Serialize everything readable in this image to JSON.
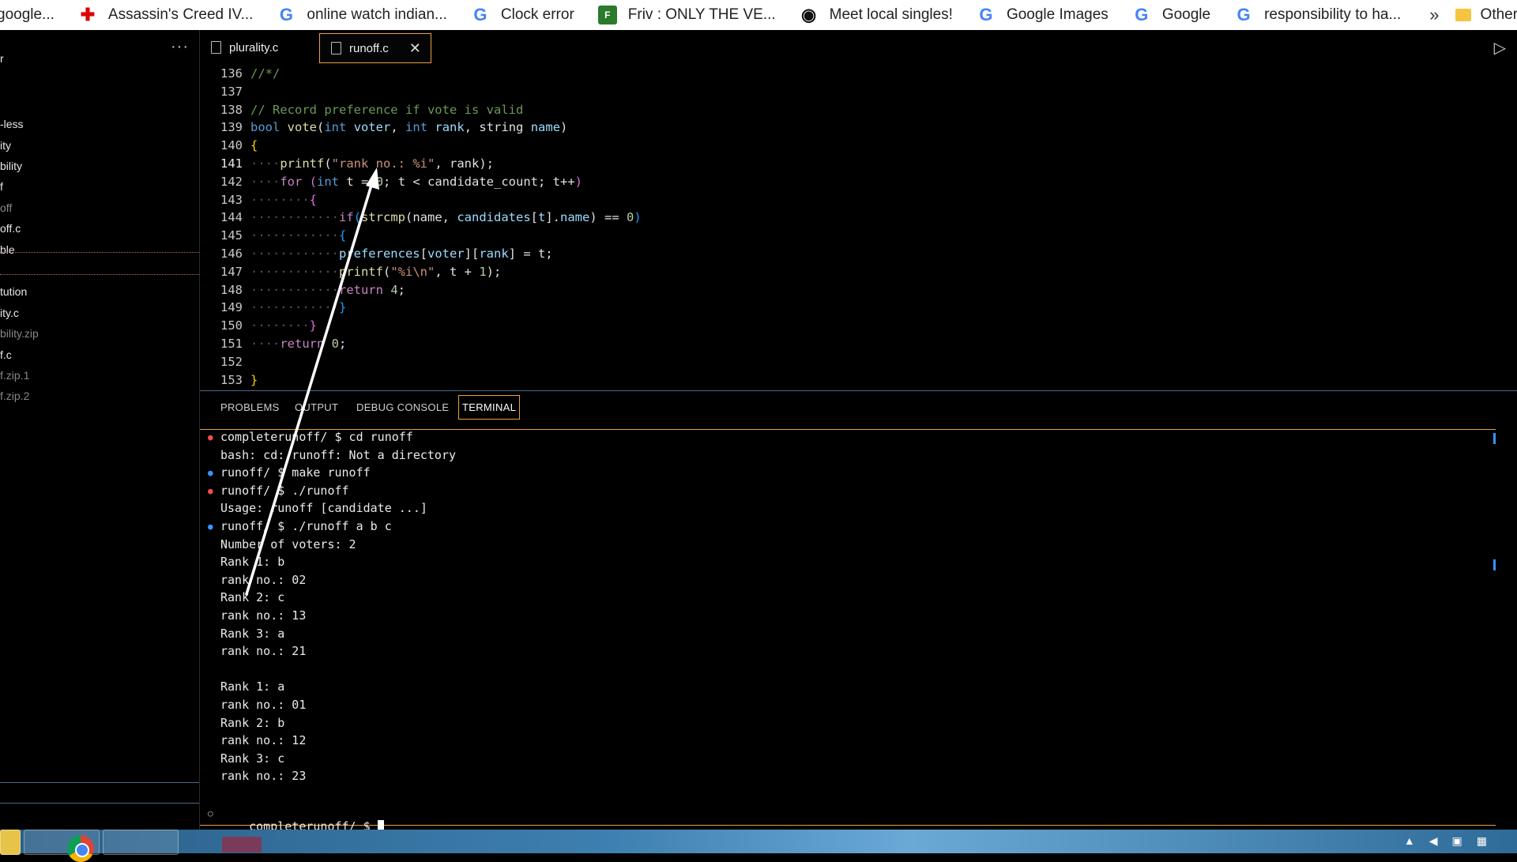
{
  "bookmarks": {
    "items": [
      {
        "label": "google...",
        "icon": "none"
      },
      {
        "label": "Assassin's Creed IV...",
        "icon": "gamepad-icon"
      },
      {
        "label": "online watch indian...",
        "icon": "google-icon"
      },
      {
        "label": "Clock error",
        "icon": "google-icon"
      },
      {
        "label": "Friv : ONLY THE VE...",
        "icon": "friv-icon"
      },
      {
        "label": "Meet local singles!",
        "icon": "globe-icon"
      },
      {
        "label": "Google Images",
        "icon": "google-icon"
      },
      {
        "label": "Google",
        "icon": "google-icon"
      },
      {
        "label": "responsibility to ha...",
        "icon": "google-icon"
      }
    ],
    "more": "»",
    "other": "Other"
  },
  "sidebar": {
    "more": "···",
    "items": [
      {
        "label": "r",
        "dim": false
      },
      {
        "label": "",
        "dim": false
      },
      {
        "label": "-less",
        "dim": false
      },
      {
        "label": "ity",
        "dim": false
      },
      {
        "label": "bility",
        "dim": false
      },
      {
        "label": "f",
        "dim": false
      },
      {
        "label": "off",
        "dim": true
      },
      {
        "label": "off.c",
        "dim": false
      },
      {
        "label": "ble",
        "dim": false
      },
      {
        "label": "",
        "dim": false
      },
      {
        "label": "tution",
        "dim": false
      },
      {
        "label": "ity.c",
        "dim": false
      },
      {
        "label": "bility.zip",
        "dim": true
      },
      {
        "label": "f.c",
        "dim": false
      },
      {
        "label": "f.zip.1",
        "dim": true
      },
      {
        "label": "f.zip.2",
        "dim": true
      }
    ]
  },
  "tabs": [
    {
      "label": "plurality.c",
      "active": false
    },
    {
      "label": "runoff.c",
      "active": true
    }
  ],
  "tab_close": "✕",
  "run_icon": "▷",
  "editor": {
    "current_line": 141,
    "lines": [
      {
        "n": 136,
        "tokens": [
          [
            "cmt",
            "//*/"
          ]
        ]
      },
      {
        "n": 137,
        "tokens": []
      },
      {
        "n": 138,
        "tokens": [
          [
            "cmt",
            "// Record preference if vote is valid"
          ]
        ]
      },
      {
        "n": 139,
        "tokens": [
          [
            "kw",
            "bool"
          ],
          [
            "txt",
            " "
          ],
          [
            "fn",
            "vote"
          ],
          [
            "txt",
            "("
          ],
          [
            "kw",
            "int"
          ],
          [
            "txt",
            " "
          ],
          [
            "var",
            "voter"
          ],
          [
            "txt",
            ", "
          ],
          [
            "kw",
            "int"
          ],
          [
            "txt",
            " "
          ],
          [
            "var",
            "rank"
          ],
          [
            "txt",
            ", "
          ],
          [
            "txt",
            "string"
          ],
          [
            "txt",
            " "
          ],
          [
            "var",
            "name"
          ],
          [
            "txt",
            ")"
          ]
        ]
      },
      {
        "n": 140,
        "tokens": [
          [
            "br1",
            "{"
          ]
        ]
      },
      {
        "n": 141,
        "tokens": [
          [
            "ws",
            "····"
          ],
          [
            "fn",
            "printf"
          ],
          [
            "txt",
            "("
          ],
          [
            "str",
            "\"rank no.: %i\""
          ],
          [
            "txt",
            ", rank);"
          ]
        ]
      },
      {
        "n": 142,
        "tokens": [
          [
            "ws",
            "····"
          ],
          [
            "ctl",
            "for"
          ],
          [
            "txt",
            " "
          ],
          [
            "br2",
            "("
          ],
          [
            "kw",
            "int"
          ],
          [
            "txt",
            " t = "
          ],
          [
            "num",
            "0"
          ],
          [
            "txt",
            "; t < candidate_count; t++"
          ],
          [
            "br2",
            ")"
          ]
        ]
      },
      {
        "n": 143,
        "tokens": [
          [
            "ws",
            "········"
          ],
          [
            "br2",
            "{"
          ]
        ]
      },
      {
        "n": 144,
        "tokens": [
          [
            "ws",
            "············"
          ],
          [
            "ctl",
            "if"
          ],
          [
            "br3",
            "("
          ],
          [
            "fn",
            "strcmp"
          ],
          [
            "txt",
            "(name, "
          ],
          [
            "var",
            "candidates"
          ],
          [
            "txt",
            "["
          ],
          [
            "var",
            "t"
          ],
          [
            "txt",
            "]."
          ],
          [
            "var",
            "name"
          ],
          [
            "txt",
            ") == "
          ],
          [
            "num",
            "0"
          ],
          [
            "br3",
            ")"
          ]
        ]
      },
      {
        "n": 145,
        "tokens": [
          [
            "ws",
            "············"
          ],
          [
            "br3",
            "{"
          ]
        ]
      },
      {
        "n": 146,
        "tokens": [
          [
            "ws",
            "············"
          ],
          [
            "var",
            "preferences"
          ],
          [
            "txt",
            "["
          ],
          [
            "var",
            "voter"
          ],
          [
            "txt",
            "]["
          ],
          [
            "var",
            "rank"
          ],
          [
            "txt",
            "] = t;"
          ]
        ]
      },
      {
        "n": 147,
        "tokens": [
          [
            "ws",
            "············"
          ],
          [
            "fn",
            "printf"
          ],
          [
            "txt",
            "("
          ],
          [
            "str",
            "\"%i\\n\""
          ],
          [
            "txt",
            ", t + "
          ],
          [
            "num",
            "1"
          ],
          [
            "txt",
            ");"
          ]
        ]
      },
      {
        "n": 148,
        "tokens": [
          [
            "ws",
            "············"
          ],
          [
            "ctl",
            "return"
          ],
          [
            "txt",
            " "
          ],
          [
            "num",
            "4"
          ],
          [
            "txt",
            ";"
          ]
        ]
      },
      {
        "n": 149,
        "tokens": [
          [
            "ws",
            "············"
          ],
          [
            "br3",
            "}"
          ]
        ]
      },
      {
        "n": 150,
        "tokens": [
          [
            "ws",
            "········"
          ],
          [
            "br2",
            "}"
          ]
        ]
      },
      {
        "n": 151,
        "tokens": [
          [
            "ws",
            "····"
          ],
          [
            "ctl",
            "return"
          ],
          [
            "txt",
            " "
          ],
          [
            "num",
            "0"
          ],
          [
            "txt",
            ";"
          ]
        ]
      },
      {
        "n": 152,
        "tokens": []
      },
      {
        "n": 153,
        "tokens": [
          [
            "br1",
            "}"
          ]
        ]
      }
    ]
  },
  "panel": {
    "tabs": [
      "PROBLEMS",
      "OUTPUT",
      "DEBUG CONSOLE",
      "TERMINAL"
    ],
    "active": "TERMINAL"
  },
  "terminal": {
    "lines": [
      {
        "text": "completerunoff/ $ cd runoff",
        "dot": "err"
      },
      {
        "text": "bash: cd: runoff: Not a directory",
        "dot": ""
      },
      {
        "text": "runoff/ $ make runoff",
        "dot": "ok"
      },
      {
        "text": "runoff/ $ ./runoff",
        "dot": "err"
      },
      {
        "text": "Usage: runoff [candidate ...]",
        "dot": ""
      },
      {
        "text": "runoff/ $ ./runoff a b c",
        "dot": "ok"
      },
      {
        "text": "Number of voters: 2",
        "dot": ""
      },
      {
        "text": "Rank 1: b",
        "dot": ""
      },
      {
        "text": "rank no.: 02",
        "dot": ""
      },
      {
        "text": "Rank 2: c",
        "dot": ""
      },
      {
        "text": "rank no.: 13",
        "dot": ""
      },
      {
        "text": "Rank 3: a",
        "dot": ""
      },
      {
        "text": "rank no.: 21",
        "dot": ""
      },
      {
        "text": "",
        "dot": ""
      },
      {
        "text": "Rank 1: a",
        "dot": ""
      },
      {
        "text": "rank no.: 01",
        "dot": ""
      },
      {
        "text": "Rank 2: b",
        "dot": ""
      },
      {
        "text": "rank no.: 12",
        "dot": ""
      },
      {
        "text": "Rank 3: c",
        "dot": ""
      },
      {
        "text": "rank no.: 23",
        "dot": ""
      }
    ],
    "prompt": "completerunoff/ $ "
  },
  "colors": {
    "accent_orange": "#e8a23c",
    "error_dot": "#f14c4c",
    "ok_dot": "#3794ff"
  }
}
